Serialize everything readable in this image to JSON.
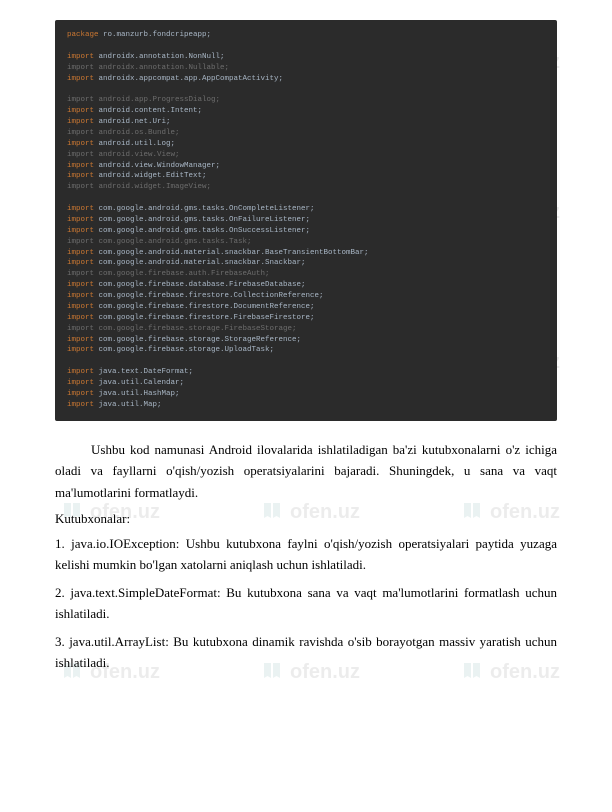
{
  "watermark_text": "ofen.uz",
  "code": {
    "l1": {
      "kw": "package",
      "txt": " ro.manzurb.fondcripeapp;"
    },
    "l2": {
      "kw": "import",
      "txt": " androidx.annotation.NonNull;"
    },
    "l3": {
      "kw": "import",
      "txt": " androidx.annotation.Nullable;"
    },
    "l4": {
      "kw": "import",
      "txt": " androidx.appcompat.app.AppCompatActivity;"
    },
    "l5": {
      "kw": "import",
      "txt": " android.app.ProgressDialog;"
    },
    "l6": {
      "kw": "import",
      "txt": " android.content.Intent;"
    },
    "l7": {
      "kw": "import",
      "txt": " android.net.Uri;"
    },
    "l8": {
      "kw": "import",
      "txt": " android.os.Bundle;"
    },
    "l9": {
      "kw": "import",
      "txt": " android.util.Log;"
    },
    "l10": {
      "kw": "import",
      "txt": " android.view.View;"
    },
    "l11": {
      "kw": "import",
      "txt": " android.view.WindowManager;"
    },
    "l12": {
      "kw": "import",
      "txt": " android.widget.EditText;"
    },
    "l13": {
      "kw": "import",
      "txt": " android.widget.ImageView;"
    },
    "l14": {
      "kw": "import",
      "txt": " com.google.android.gms.tasks.OnCompleteListener;"
    },
    "l15": {
      "kw": "import",
      "txt": " com.google.android.gms.tasks.OnFailureListener;"
    },
    "l16": {
      "kw": "import",
      "txt": " com.google.android.gms.tasks.OnSuccessListener;"
    },
    "l17": {
      "kw": "import",
      "txt": " com.google.android.gms.tasks.Task;"
    },
    "l18": {
      "kw": "import",
      "txt": " com.google.android.material.snackbar.BaseTransientBottomBar;"
    },
    "l19": {
      "kw": "import",
      "txt": " com.google.android.material.snackbar.Snackbar;"
    },
    "l20": {
      "kw": "import",
      "txt": " com.google.firebase.auth.FirebaseAuth;"
    },
    "l21": {
      "kw": "import",
      "txt": " com.google.firebase.database.FirebaseDatabase;"
    },
    "l22": {
      "kw": "import",
      "txt": " com.google.firebase.firestore.CollectionReference;"
    },
    "l23": {
      "kw": "import",
      "txt": " com.google.firebase.firestore.DocumentReference;"
    },
    "l24": {
      "kw": "import",
      "txt": " com.google.firebase.firestore.FirebaseFirestore;"
    },
    "l25": {
      "kw": "import",
      "txt": " com.google.firebase.storage.FirebaseStorage;"
    },
    "l26": {
      "kw": "import",
      "txt": " com.google.firebase.storage.StorageReference;"
    },
    "l27": {
      "kw": "import",
      "txt": " com.google.firebase.storage.UploadTask;"
    },
    "l28": {
      "kw": "import",
      "txt": " java.text.DateFormat;"
    },
    "l29": {
      "kw": "import",
      "txt": " java.util.Calendar;"
    },
    "l30": {
      "kw": "import",
      "txt": " java.util.HashMap;"
    },
    "l31": {
      "kw": "import",
      "txt": " java.util.Map;"
    }
  },
  "text": {
    "p1": "Ushbu kod namunasi Android ilovalarida ishlatiladigan ba'zi kutubxonalarni o'z ichiga oladi va fayllarni o'qish/yozish operatsiyalarini bajaradi. Shuningdek, u sana va vaqt ma'lumotlarini formatlaydi.",
    "h1": "Kutubxonalar:",
    "li1": "1. java.io.IOException: Ushbu kutubxona faylni o'qish/yozish operatsiyalari paytida yuzaga kelishi mumkin bo'lgan xatolarni aniqlash uchun ishlatiladi.",
    "li2": "2. java.text.SimpleDateFormat: Bu kutubxona sana va vaqt ma'lumotlarini formatlash uchun ishlatiladi.",
    "li3": "3. java.util.ArrayList: Bu kutubxona dinamik ravishda o'sib borayotgan massiv yaratish uchun ishlatiladi."
  }
}
